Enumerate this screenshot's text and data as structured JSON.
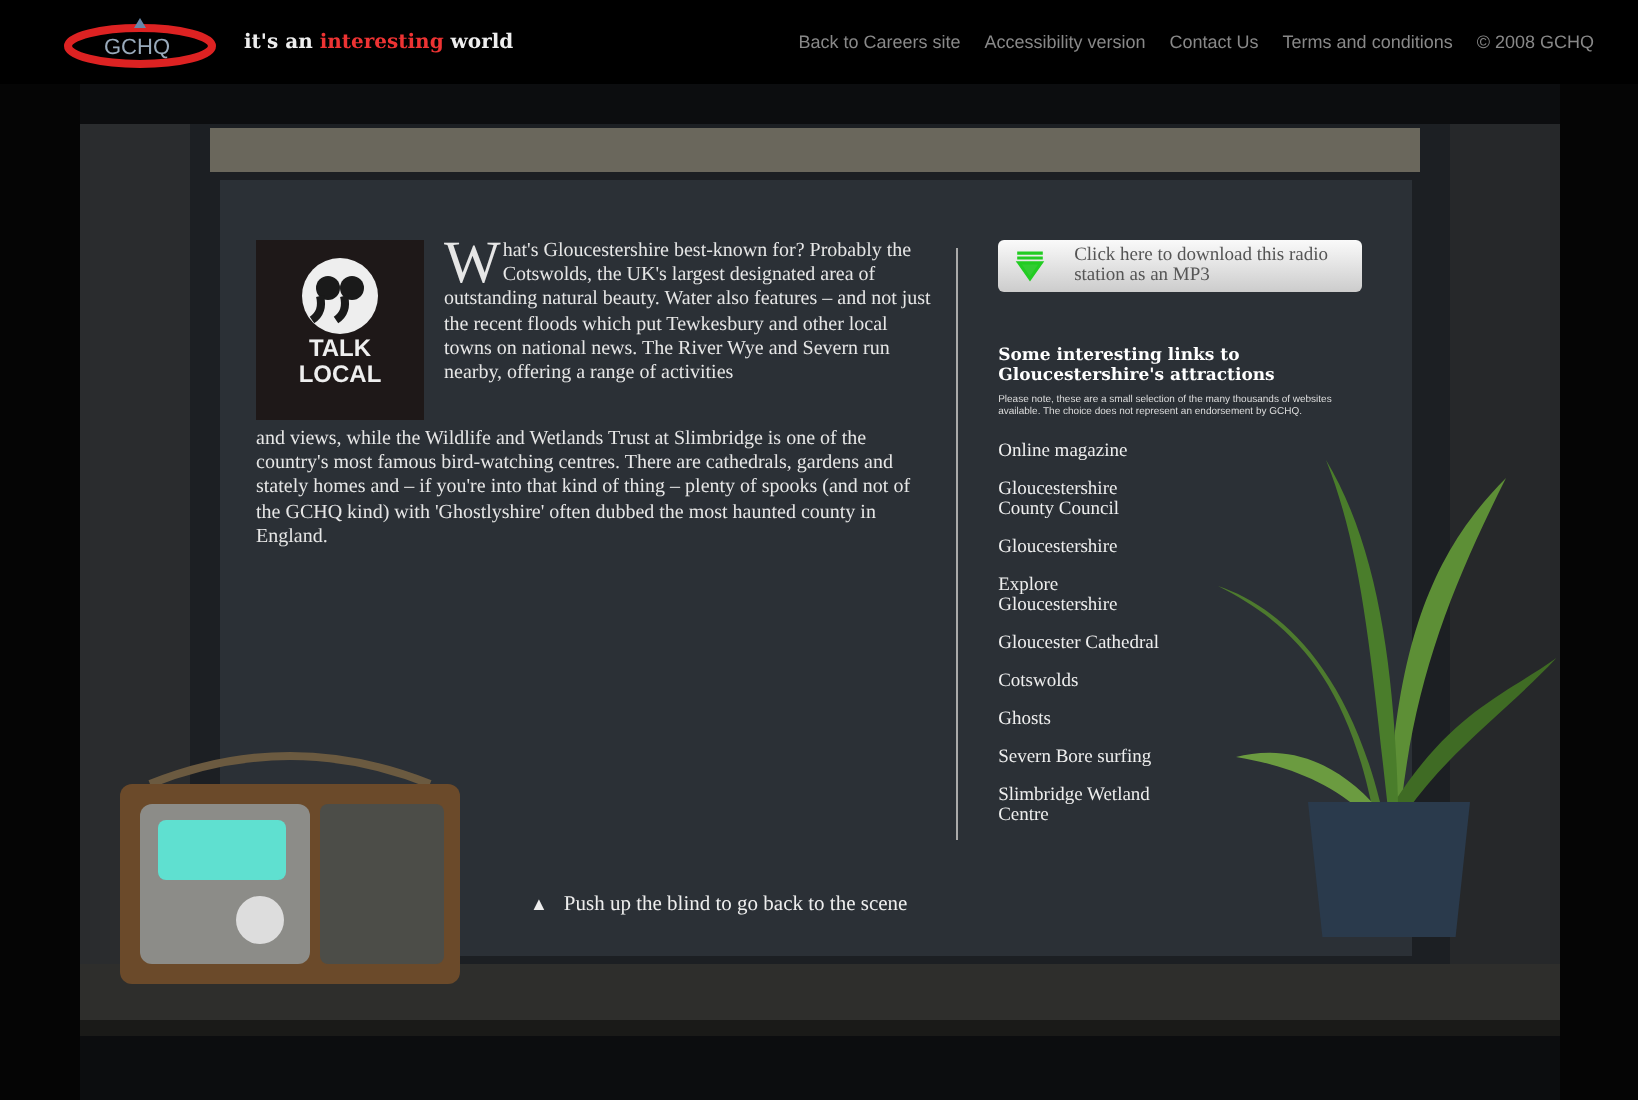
{
  "header": {
    "logo_text": "GCHQ",
    "tagline": {
      "before": "it's an ",
      "highlight": "interesting",
      "after": " world"
    },
    "nav": [
      "Back to Careers site",
      "Accessibility version",
      "Contact Us",
      "Terms and conditions",
      "© 2008 GCHQ"
    ]
  },
  "article": {
    "logo": {
      "word_1": "TALK",
      "word_2": "LOCAL"
    },
    "drop_cap": "W",
    "text_1": "hat's Gloucestershire best-known for? Probably the Cotswolds, the UK's largest designated area of outstanding natural beauty. Water also features – and not just the recent floods which put Tewkesbury and other local towns on national news. The River Wye and Severn run nearby, offering a range of activities",
    "text_2": "and views, while the Wildlife and Wetlands Trust at Slimbridge is one of the country's most famous bird-watching centres. There are cathedrals, gardens and stately homes and – if you're into that kind of thing – plenty of spooks (and not of the GCHQ kind) with 'Ghostlyshire' often dubbed the most haunted county in England."
  },
  "download_button": "Click here to download this radio station as an MP3",
  "links": {
    "heading": "Some interesting links to Gloucestershire's attractions",
    "note": "Please note, these are a small selection of the many thousands of websites available. The choice does not represent an endorsement by GCHQ.",
    "items": [
      "Online magazine",
      "Gloucestershire County Council",
      "Gloucestershire",
      "Explore Gloucestershire",
      "Gloucester Cathedral",
      "Cotswolds",
      "Ghosts",
      "Severn Bore surfing",
      "Slimbridge Wetland Centre"
    ]
  },
  "back_link": {
    "icon": "▲",
    "label": "Push up the blind to go back to the scene"
  }
}
